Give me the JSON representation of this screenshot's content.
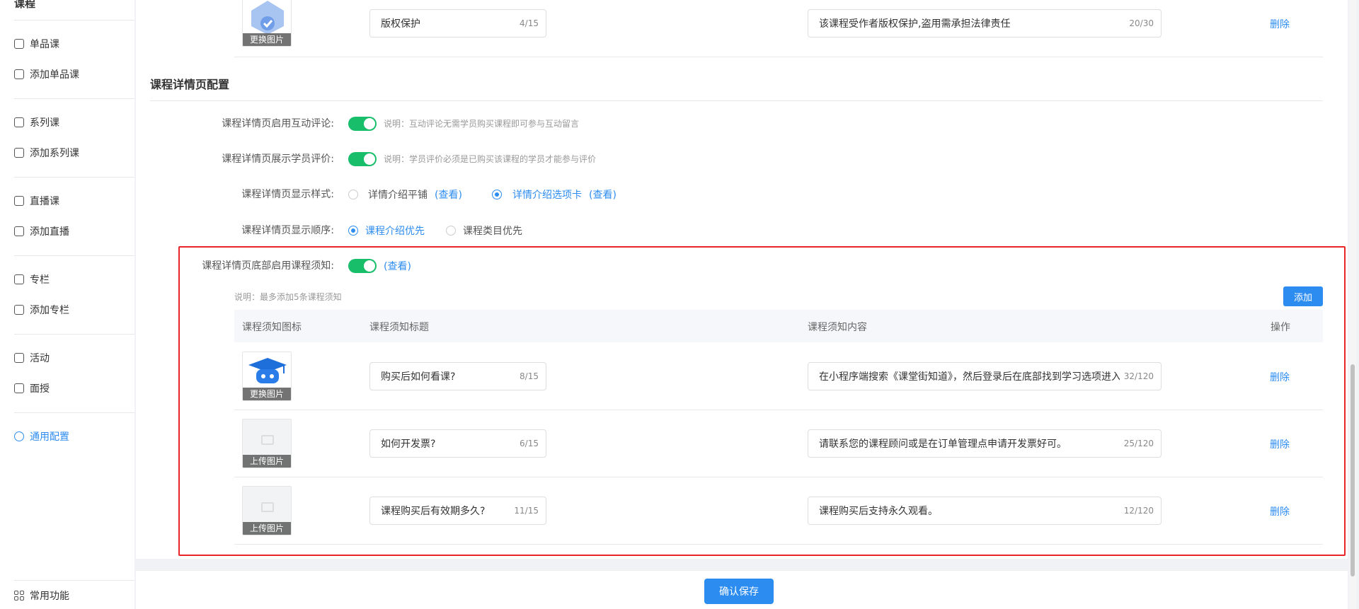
{
  "sidebar": {
    "section_title": "课程",
    "items": [
      {
        "label": "单品课"
      },
      {
        "label": "添加单品课"
      },
      {
        "label": "系列课"
      },
      {
        "label": "添加系列课"
      },
      {
        "label": "直播课"
      },
      {
        "label": "添加直播"
      },
      {
        "label": "专栏"
      },
      {
        "label": "添加专栏"
      },
      {
        "label": "活动"
      },
      {
        "label": "面授"
      },
      {
        "label": "通用配置"
      }
    ],
    "bottom_item": "常用功能"
  },
  "top_row": {
    "image_label": "更换图片",
    "title_value": "版权保护",
    "title_count": "4/15",
    "content_value": "该课程受作者版权保护,盗用需承担法律责任",
    "content_count": "20/30",
    "delete": "删除"
  },
  "detail_config": {
    "section_title": "课程详情页配置",
    "comments_label": "课程详情页启用互动评论:",
    "comments_note": "说明：互动评论无需学员购买课程即可参与互动留言",
    "reviews_label": "课程详情页展示学员评价:",
    "reviews_note": "说明：学员评价必须是已购买该课程的学员才能参与评价",
    "style_label": "课程详情页显示样式:",
    "style_option1": "详情介绍平铺",
    "style_option1_link": "(查看)",
    "style_option2": "详情介绍选项卡",
    "style_option2_link": "(查看)",
    "order_label": "课程详情页显示顺序:",
    "order_option1": "课程介绍优先",
    "order_option2": "课程类目优先",
    "notice_label": "课程详情页底部启用课程须知:",
    "notice_link": "(查看)",
    "notice_note": "说明：最多添加5条课程须知",
    "add_button": "添加"
  },
  "notice_table": {
    "headers": [
      "课程须知图标",
      "课程须知标题",
      "课程须知内容",
      "操作"
    ],
    "rows": [
      {
        "image_label": "更换图片",
        "has_icon": true,
        "title": "购买后如何看课?",
        "title_count": "8/15",
        "content": "在小程序端搜索《课堂街知道》，然后登录后在底部找到学习选项进入",
        "content_count": "32/120",
        "action": "删除"
      },
      {
        "image_label": "上传图片",
        "has_icon": false,
        "title": "如何开发票?",
        "title_count": "6/15",
        "content": "请联系您的课程顾问或是在订单管理点申请开发票好可。",
        "content_count": "25/120",
        "action": "删除"
      },
      {
        "image_label": "上传图片",
        "has_icon": false,
        "title": "课程购买后有效期多久?",
        "title_count": "11/15",
        "content": "课程购买后支持永久观看。",
        "content_count": "12/120",
        "action": "删除"
      }
    ]
  },
  "footer": {
    "save_button": "确认保存"
  },
  "colors": {
    "accent": "#2d8cf0",
    "toggle_on": "#19be6b",
    "highlight_border": "#e8262a"
  }
}
